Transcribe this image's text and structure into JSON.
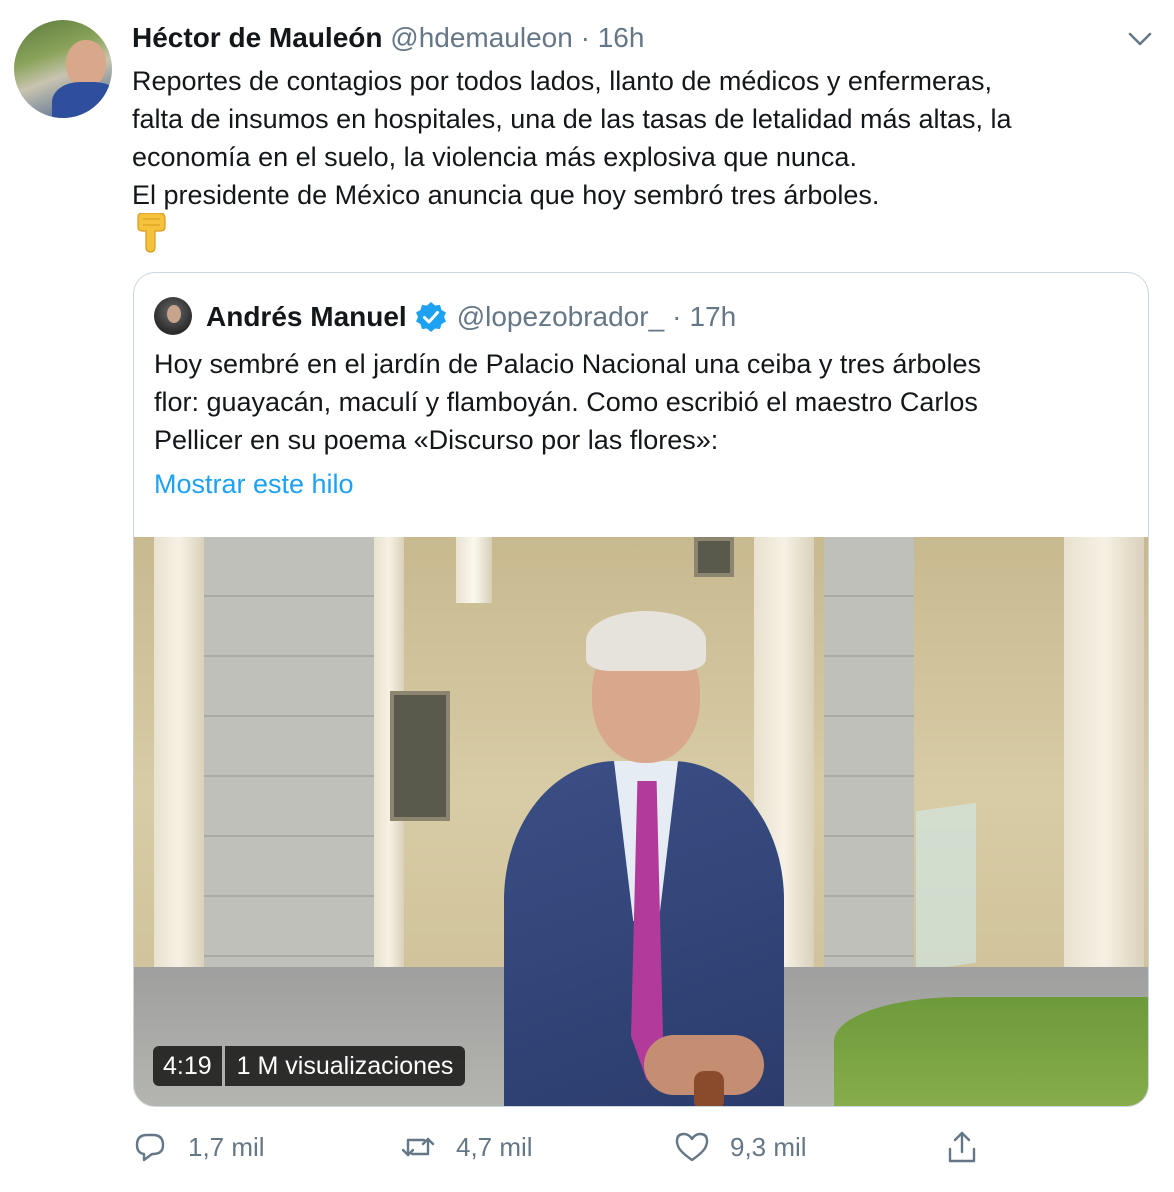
{
  "tweet": {
    "author_name": "Héctor de Mauleón",
    "author_handle": "@hdemauleon",
    "separator": "·",
    "time": "16h",
    "text_lines": [
      "Reportes de contagios por todos lados, llanto de médicos y enfermeras,",
      "falta de insumos en hospitales, una de las tasas de letalidad más altas, la",
      "economía en el suelo, la violencia más explosiva que nunca.",
      "El presidente de México anuncia que hoy sembró tres árboles."
    ],
    "emoji_icon": "pointing-down-hand-icon"
  },
  "quote": {
    "author_name": "Andrés Manuel",
    "verified_icon": "verified-badge-icon",
    "author_handle": "@lopezobrador_",
    "separator": "·",
    "time": "17h",
    "text_lines": [
      "Hoy sembré en el jardín de Palacio Nacional una ceiba y tres árboles",
      "flor: guayacán, maculí y flamboyán. Como escribió el maestro Carlos",
      "Pellicer en su poema «Discurso por las flores»:"
    ],
    "show_thread": "Mostrar este hilo",
    "video": {
      "duration": "4:19",
      "views": "1 M visualizaciones"
    }
  },
  "actions": {
    "reply_count": "1,7 mil",
    "retweet_count": "4,7 mil",
    "like_count": "9,3 mil"
  },
  "colors": {
    "link": "#1da1f2",
    "secondary_text": "#657786",
    "verified": "#1da1f2",
    "border": "#ccd6dd"
  }
}
